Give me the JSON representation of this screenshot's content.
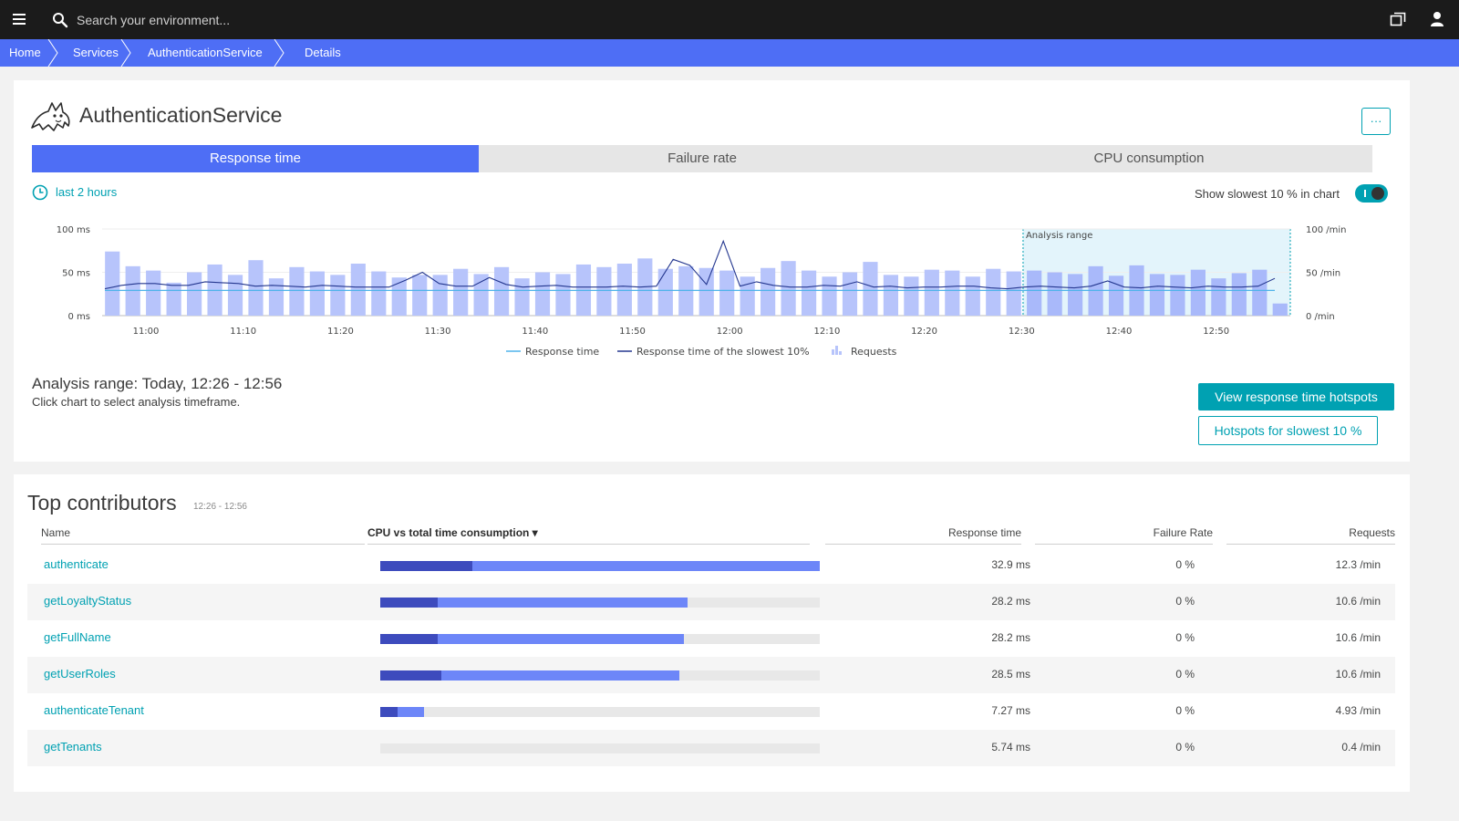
{
  "topbar": {
    "search_placeholder": "Search your environment..."
  },
  "breadcrumb": [
    "Home",
    "Services",
    "AuthenticationService",
    "Details"
  ],
  "service": {
    "title": "AuthenticationService",
    "more_label": "···"
  },
  "tabs": [
    "Response time",
    "Failure rate",
    "CPU consumption"
  ],
  "timeframe_label": "last 2 hours",
  "toggle_label": "Show slowest 10 % in chart",
  "chart_data": {
    "type": "bar",
    "x_ticks": [
      "11:00",
      "11:10",
      "11:20",
      "11:30",
      "11:40",
      "11:50",
      "12:00",
      "12:10",
      "12:20",
      "12:30",
      "12:40",
      "12:50"
    ],
    "y_left_ticks": [
      "100 ms",
      "50 ms",
      "0 ms"
    ],
    "y_right_ticks": [
      "100 /min",
      "50 /min",
      "0 /min"
    ],
    "ylim": [
      0,
      100
    ],
    "analysis_range_label": "Analysis range",
    "analysis_range_start_index": 45,
    "series": [
      {
        "name": "Requests",
        "values": [
          74,
          57,
          52,
          38,
          50,
          59,
          47,
          64,
          43,
          56,
          51,
          47,
          60,
          51,
          44,
          47,
          47,
          54,
          48,
          56,
          43,
          50,
          48,
          59,
          56,
          60,
          66,
          54,
          57,
          55,
          52,
          45,
          55,
          63,
          52,
          45,
          50,
          62,
          47,
          45,
          53,
          52,
          45,
          54,
          51,
          52,
          50,
          48,
          57,
          46,
          58,
          48,
          47,
          53,
          43,
          49,
          53,
          14
        ]
      },
      {
        "name": "Response time",
        "values": [
          29,
          29,
          29,
          29,
          29,
          29,
          29,
          29,
          29,
          29,
          29,
          29,
          29,
          29,
          29,
          29,
          29,
          29,
          29,
          29,
          29,
          29,
          29,
          29,
          29,
          29,
          29,
          29,
          29,
          29,
          29,
          29,
          29,
          29,
          29,
          29,
          29,
          29,
          29,
          29,
          29,
          29,
          29,
          29,
          29,
          29,
          29,
          29,
          29,
          29,
          29,
          29,
          29,
          29,
          29,
          29,
          29,
          29,
          29
        ]
      },
      {
        "name": "Response time of the slowest 10%",
        "values": [
          31,
          35,
          37,
          37,
          35,
          35,
          39,
          38,
          37,
          34,
          35,
          34,
          33,
          35,
          34,
          33,
          33,
          33,
          41,
          50,
          37,
          34,
          34,
          44,
          36,
          33,
          34,
          35,
          33,
          33,
          33,
          34,
          33,
          34,
          65,
          58,
          36,
          86,
          34,
          39,
          35,
          33,
          33,
          35,
          34,
          39,
          33,
          34,
          32,
          33,
          33,
          34,
          34,
          32,
          31,
          33,
          34,
          33,
          32,
          34,
          40,
          33,
          32,
          34,
          33,
          32,
          34,
          33,
          33,
          34,
          43
        ]
      }
    ]
  },
  "analysis": {
    "title": "Analysis range: Today, 12:26 - 12:56",
    "subtitle": "Click chart to select analysis timeframe.",
    "primary_button": "View response time hotspots",
    "secondary_button": "Hotspots for slowest 10 %"
  },
  "contributors": {
    "title": "Top contributors",
    "range": "12:26 - 12:56",
    "columns": {
      "name": "Name",
      "cpu": "CPU vs total time consumption ▾",
      "response_time": "Response time",
      "failure_rate": "Failure Rate",
      "requests": "Requests"
    },
    "rows": [
      {
        "name": "authenticate",
        "cpu_share": 0.21,
        "total_share": 1.0,
        "response_time": "32.9 ms",
        "failure_rate": "0 %",
        "requests": "12.3 /min"
      },
      {
        "name": "getLoyaltyStatus",
        "cpu_share": 0.13,
        "total_share": 0.7,
        "response_time": "28.2 ms",
        "failure_rate": "0 %",
        "requests": "10.6 /min"
      },
      {
        "name": "getFullName",
        "cpu_share": 0.13,
        "total_share": 0.69,
        "response_time": "28.2 ms",
        "failure_rate": "0 %",
        "requests": "10.6 /min"
      },
      {
        "name": "getUserRoles",
        "cpu_share": 0.14,
        "total_share": 0.68,
        "response_time": "28.5 ms",
        "failure_rate": "0 %",
        "requests": "10.6 /min"
      },
      {
        "name": "authenticateTenant",
        "cpu_share": 0.04,
        "total_share": 0.1,
        "response_time": "7.27 ms",
        "failure_rate": "0 %",
        "requests": "4.93 /min"
      },
      {
        "name": "getTenants",
        "cpu_share": 0.0,
        "total_share": 0.0,
        "response_time": "5.74 ms",
        "failure_rate": "0 %",
        "requests": "0.4 /min"
      }
    ]
  },
  "colors": {
    "topbar": "#1b1b1b",
    "breadcrumb": "#4e6ef5",
    "accent": "#00a1b2",
    "tab_active": "#4e6ef5",
    "bar": "#b7c4fb",
    "bar_in_range": "#a9b9fa",
    "range_fill": "#e3f4fb",
    "cpu": "#3d4bbd",
    "total": "#6d86f8"
  }
}
